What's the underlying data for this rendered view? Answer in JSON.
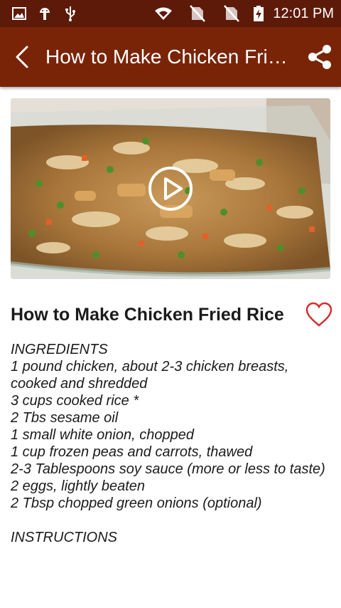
{
  "status_bar": {
    "time": "12:01 PM",
    "icons": [
      "image-icon",
      "android-icon",
      "usb-icon",
      "wifi-icon",
      "no-sim-icon",
      "no-sim-icon",
      "battery-charging-icon"
    ]
  },
  "app_bar": {
    "title": "How to Make Chicken Fried Rice",
    "back_icon": "arrow-back-icon",
    "share_icon": "share-icon"
  },
  "video": {
    "play_icon": "play-icon",
    "thumbnail": "chicken fried rice in glass dish"
  },
  "recipe": {
    "title": "How to Make Chicken Fried Rice",
    "favorite_icon": "heart-outline-icon",
    "lines": [
      "INGREDIENTS",
      "1 pound chicken, about 2-3 chicken breasts, cooked and shredded",
      "3 cups cooked rice *",
      "2 Tbs sesame oil",
      "1 small white onion, chopped",
      "1 cup frozen peas and carrots, thawed",
      "2-3 Tablespoons soy sauce (more or less to taste)",
      "2 eggs, lightly beaten",
      "2 Tbsp chopped green onions (optional)",
      "",
      "INSTRUCTIONS"
    ]
  },
  "colors": {
    "status_bar": "#5d1a08",
    "app_bar": "#7a2407",
    "accent_heart": "#d32f2f"
  }
}
